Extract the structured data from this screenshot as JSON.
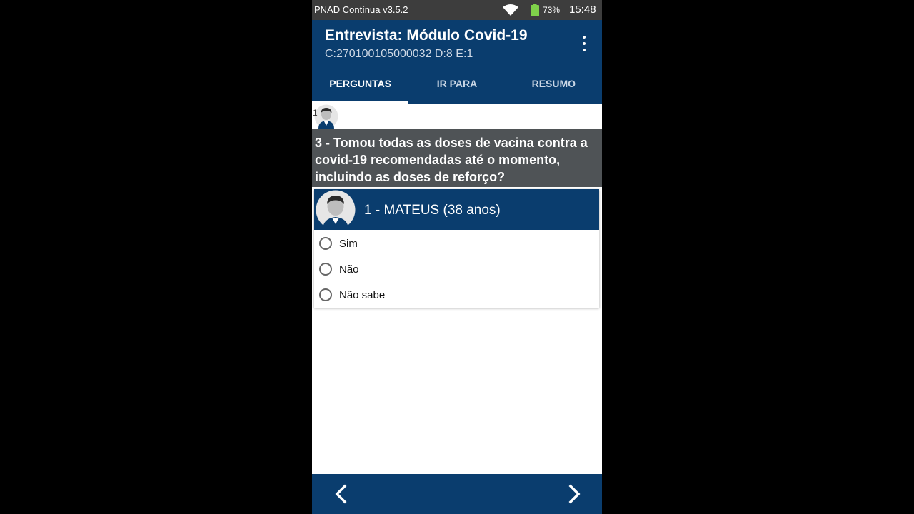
{
  "status_bar": {
    "app_version": "PNAD Contínua v3.5.2",
    "battery": "73%",
    "time": "15:48",
    "icons": [
      "wifi-icon",
      "battery-icon"
    ]
  },
  "app_bar": {
    "title": "Entrevista: Módulo Covid-19",
    "subtitle": "C:270100105000032 D:8 E:1",
    "menu_icon": "more-vert-icon",
    "tabs": [
      {
        "label": "PERGUNTAS",
        "active": true
      },
      {
        "label": "IR PARA",
        "active": false
      },
      {
        "label": "RESUMO",
        "active": false
      }
    ]
  },
  "member_strip": {
    "number": "1"
  },
  "question": {
    "text": "3 - Tomou todas as doses de vacina contra a covid-19 recomendadas até o momento, incluindo as doses de reforço?"
  },
  "person": {
    "name": "1 - MATEUS (38 anos)",
    "options": [
      {
        "label": "Sim",
        "selected": false
      },
      {
        "label": "Não",
        "selected": false
      },
      {
        "label": "Não sabe",
        "selected": false
      }
    ]
  },
  "navigation": {
    "prev_icon": "chevron-left-icon",
    "next_icon": "chevron-right-icon"
  },
  "colors": {
    "primary": "#0a3d6e",
    "question_bg": "#4f5356",
    "status_bar": "#3d3d3d"
  }
}
